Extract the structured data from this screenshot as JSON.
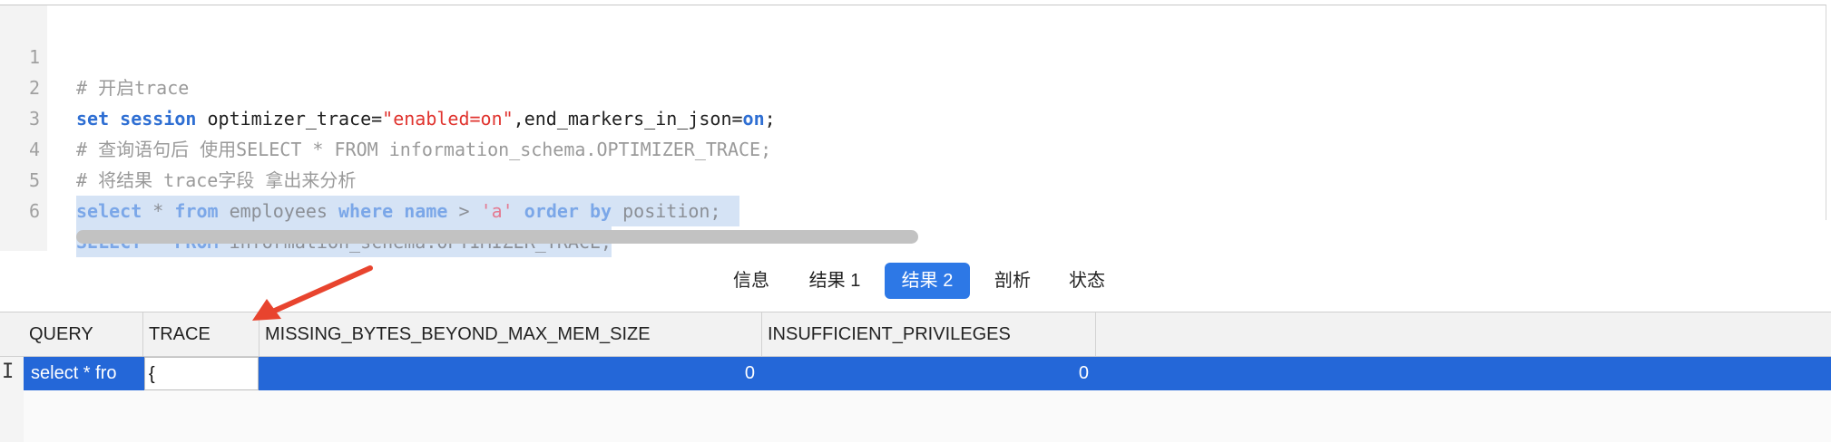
{
  "editor": {
    "lines": [
      {
        "num": "1",
        "text": "# 开启trace"
      },
      {
        "num": "2",
        "parts": [
          "set",
          " ",
          "session",
          " optimizer_trace=",
          "\"enabled=on\"",
          ",end_markers_in_json=",
          "on",
          ";"
        ]
      },
      {
        "num": "3",
        "text": "# 查询语句后 使用SELECT * FROM information_schema.OPTIMIZER_TRACE;"
      },
      {
        "num": "4",
        "text": "# 将结果 trace字段 拿出来分析"
      },
      {
        "num": "5",
        "parts": [
          "select",
          " * ",
          "from",
          " employees ",
          "where",
          " ",
          "name",
          " > ",
          "'a'",
          " ",
          "order",
          " ",
          "by",
          " position;"
        ]
      },
      {
        "num": "6",
        "parts": [
          "SELECT",
          " * ",
          "FROM",
          " information_schema.OPTIMIZER_TRACE;"
        ]
      }
    ]
  },
  "tabs": [
    {
      "label": "信息",
      "active": false
    },
    {
      "label": "结果 1",
      "active": false
    },
    {
      "label": "结果 2",
      "active": true
    },
    {
      "label": "剖析",
      "active": false
    },
    {
      "label": "状态",
      "active": false
    }
  ],
  "grid": {
    "columns": [
      "QUERY",
      "TRACE",
      "MISSING_BYTES_BEYOND_MAX_MEM_SIZE",
      "INSUFFICIENT_PRIVILEGES"
    ],
    "rows": [
      {
        "query": "select * fro",
        "trace": "{",
        "missing_bytes": "0",
        "insufficient_privileges": "0"
      }
    ]
  },
  "colors": {
    "accent": "#2d78e6",
    "row_selected": "#2467d8",
    "arrow": "#e8442e",
    "selection": "#d5e3f5"
  },
  "icons": {
    "row_cursor": "text-cursor-icon",
    "annotation": "red-arrow-icon"
  }
}
